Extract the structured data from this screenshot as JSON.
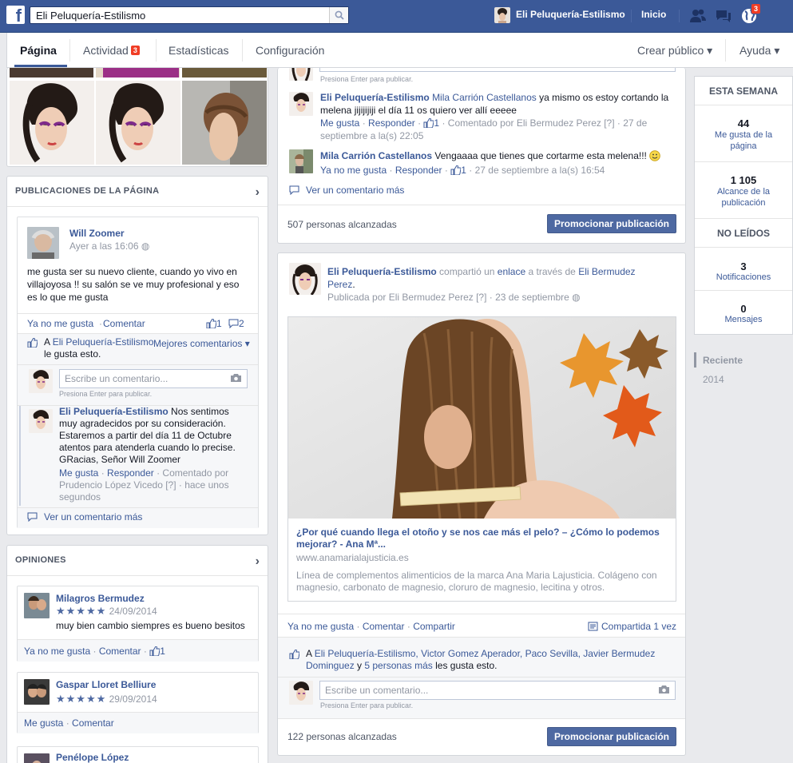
{
  "topbar": {
    "search_value": "Eli Peluquería-Estilismo",
    "page_name": "Eli Peluquería-Estilismo",
    "home": "Inicio",
    "notif_count": "3"
  },
  "tabs": {
    "pagina": "Página",
    "actividad": "Actividad",
    "actividad_badge": "3",
    "estadisticas": "Estadísticas",
    "configuracion": "Configuración",
    "crear": "Crear público ▾",
    "ayuda": "Ayuda ▾"
  },
  "left": {
    "posts_header": "PUBLICACIONES DE LA PÁGINA",
    "post": {
      "author": "Will Zoomer",
      "time": "Ayer a las 16:06",
      "text": "me gusta ser su nuevo cliente, cuando yo vivo en villajoyosa !! su salón se ve muy profesional y eso es lo que me gusta",
      "unlike": "Ya no me gusta",
      "comment": "Comentar",
      "like_count": "1",
      "comment_count": "2",
      "likes_prefix": "A ",
      "likes_name": "Eli Peluquería-Estilismo",
      "likes_suffix": " le gusta esto.",
      "best_comments": "Mejores comentarios ▾",
      "input_placeholder": "Escribe un comentario...",
      "enter_hint": "Presiona Enter para publicar.",
      "reply_author": "Eli Peluquería-Estilismo",
      "reply_text": " Nos sentimos muy agradecidos por su consideración. Estaremos a partir del día 11 de Octubre atentos para atenderla cuando lo precise. GRacias, Señor Will Zoomer",
      "reply_like": "Me gusta",
      "reply_reply": "Responder",
      "reply_meta": "Comentado por Prudencio López Vicedo [?] · hace unos segundos",
      "more_comments": "Ver un comentario más"
    },
    "reviews_header": "OPINIONES",
    "reviews": [
      {
        "name": "Milagros Bermudez",
        "stars": "★★★★★",
        "date": "24/09/2014",
        "text": "muy bien cambio siempres es bueno besitos",
        "action1": "Ya no me gusta",
        "action2": "Comentar",
        "likes": "1"
      },
      {
        "name": "Gaspar Lloret Belliure",
        "stars": "★★★★★",
        "date": "29/09/2014",
        "action1": "Me gusta",
        "action2": "Comentar"
      },
      {
        "name": "Penélope López"
      }
    ]
  },
  "center": {
    "top_hint": "Presiona Enter para publicar.",
    "c1_author": "Eli Peluquería-Estilismo",
    "c1_mention": "Mila Carrión Castellanos",
    "c1_text": " ya mismo os estoy cortando la melena jijijijiji el día 11 os quiero ver allí eeeee",
    "c1_like": "Me gusta",
    "c1_reply": "Responder",
    "c1_count": "1",
    "c1_meta": "· Comentado por Eli Bermudez Perez [?] · 27 de septiembre a la(s) 22:05",
    "c2_author": "Mila Carrión Castellanos",
    "c2_text": " Vengaaaa que tienes que cortarme esta melena!!! ",
    "c2_unlike": "Ya no me gusta",
    "c2_reply": "Responder",
    "c2_count": "1",
    "c2_meta": "· 27 de septiembre a la(s) 16:54",
    "more_comments": "Ver un comentario más",
    "reach1": "507 personas alcanzadas",
    "promote1": "Promocionar publicación",
    "post2_author": "Eli Peluquería-Estilismo",
    "post2_shared": " compartió un ",
    "post2_link": "enlace",
    "post2_via": " a través de ",
    "post2_via_name": "Eli Bermudez Perez",
    "post2_meta": "Publicada por Eli Bermudez Perez [?] · 23 de septiembre",
    "link_title": "¿Por qué cuando llega el otoño y se nos cae más el pelo? – ¿Cómo lo podemos mejorar? - Ana Mª...",
    "link_domain": "www.anamarialajusticia.es",
    "link_desc": "Línea de complementos alimenticios de la marca Ana Maria Lajusticia. Colágeno con magnesio, carbonato de magnesio, cloruro de magnesio, lecitina y otros.",
    "act_unlike": "Ya no me gusta",
    "act_comment": "Comentar",
    "act_share": "Compartir",
    "shared_count": "Compartida 1 vez",
    "likes_prefix": "A ",
    "likes_names": "Eli Peluquería-Estilismo, Victor Gomez Aperador, Paco Sevilla, Javier Bermudez Dominguez",
    "likes_and": " y ",
    "likes_more": "5 personas más",
    "likes_suffix": " les gusta esto.",
    "input_placeholder": "Escribe un comentario...",
    "enter_hint": "Presiona Enter para publicar.",
    "reach2": "122 personas alcanzadas",
    "promote2": "Promocionar publicación"
  },
  "right": {
    "week_header": "ESTA SEMANA",
    "likes_num": "44",
    "likes_label": "Me gusta de la página",
    "reach_num": "1 105",
    "reach_label": "Alcance de la publicación",
    "unread_header": "NO LEÍDOS",
    "notif_num": "3",
    "notif_label": "Notificaciones",
    "msg_num": "0",
    "msg_label": "Mensajes",
    "timeline_recent": "Reciente",
    "timeline_year": "2014"
  },
  "colors": {
    "brand": "#3b5998",
    "badge": "#f03d25",
    "button": "#4e69a2"
  },
  "icons": [
    "search-icon",
    "friends-icon",
    "messages-icon",
    "globe-icon",
    "thumbs-up-icon",
    "comment-icon",
    "camera-icon",
    "chevron-right-icon",
    "share-icon",
    "smiley-icon"
  ]
}
